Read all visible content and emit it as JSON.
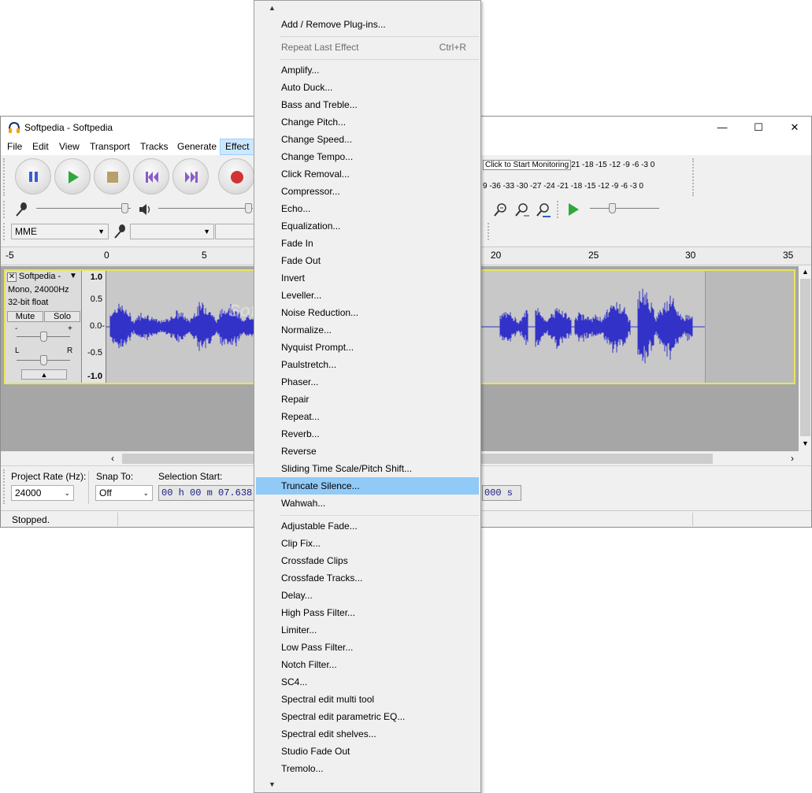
{
  "window": {
    "title": "Softpedia - Softpedia",
    "minimize_glyph": "—",
    "maximize_glyph": "☐",
    "close_glyph": "✕"
  },
  "menubar": [
    "File",
    "Edit",
    "View",
    "Transport",
    "Tracks",
    "Generate",
    "Effect"
  ],
  "meters": {
    "record_tooltip": "Click to Start Monitoring",
    "record_scale": "21 -18 -15 -12  -9  -6  -3  0",
    "play_scale": "9 -36 -33 -30 -27 -24 -21 -18 -15 -12  -9  -6  -3  0"
  },
  "device": {
    "host": "MME"
  },
  "ruler": [
    "-5",
    "0",
    "5",
    "20",
    "25",
    "30",
    "35"
  ],
  "track": {
    "name": "Softpedia -",
    "info_line1": "Mono, 24000Hz",
    "info_line2": "32-bit float",
    "mute_label": "Mute",
    "solo_label": "Solo",
    "gain_minus": "-",
    "gain_plus": "+",
    "pan_left": "L",
    "pan_right": "R",
    "scale": [
      "1.0",
      "0.5",
      "0.0-",
      "-0.5",
      "-1.0"
    ],
    "watermark": "Softpedia"
  },
  "selection_toolbar": {
    "project_rate_label": "Project Rate (Hz):",
    "project_rate_value": "24000",
    "snap_to_label": "Snap To:",
    "snap_to_value": "Off",
    "selection_start_label": "Selection Start:",
    "selection_start_value": "00 h 00 m 07.638",
    "selection_end_value": "000 s"
  },
  "status": {
    "text": "Stopped."
  },
  "effect_menu": {
    "top_items": [
      {
        "label": "Add / Remove Plug-ins..."
      }
    ],
    "repeat": {
      "label": "Repeat Last Effect",
      "shortcut": "Ctrl+R"
    },
    "builtin": [
      "Amplify...",
      "Auto Duck...",
      "Bass and Treble...",
      "Change Pitch...",
      "Change Speed...",
      "Change Tempo...",
      "Click Removal...",
      "Compressor...",
      "Echo...",
      "Equalization...",
      "Fade In",
      "Fade Out",
      "Invert",
      "Leveller...",
      "Noise Reduction...",
      "Normalize...",
      "Nyquist Prompt...",
      "Paulstretch...",
      "Phaser...",
      "Repair",
      "Repeat...",
      "Reverb...",
      "Reverse",
      "Sliding Time Scale/Pitch Shift...",
      "Truncate Silence...",
      "Wahwah..."
    ],
    "selected": "Truncate Silence...",
    "plugins": [
      "Adjustable Fade...",
      "Clip Fix...",
      "Crossfade Clips",
      "Crossfade Tracks...",
      "Delay...",
      "High Pass Filter...",
      "Limiter...",
      "Low Pass Filter...",
      "Notch Filter...",
      "SC4...",
      "Spectral edit multi tool",
      "Spectral edit parametric EQ...",
      "Spectral edit shelves...",
      "Studio Fade Out",
      "Tremolo..."
    ]
  },
  "colors": {
    "waveform": "#3232c8",
    "track_border": "#e9e55a",
    "menu_highlight": "#91c9f7"
  }
}
